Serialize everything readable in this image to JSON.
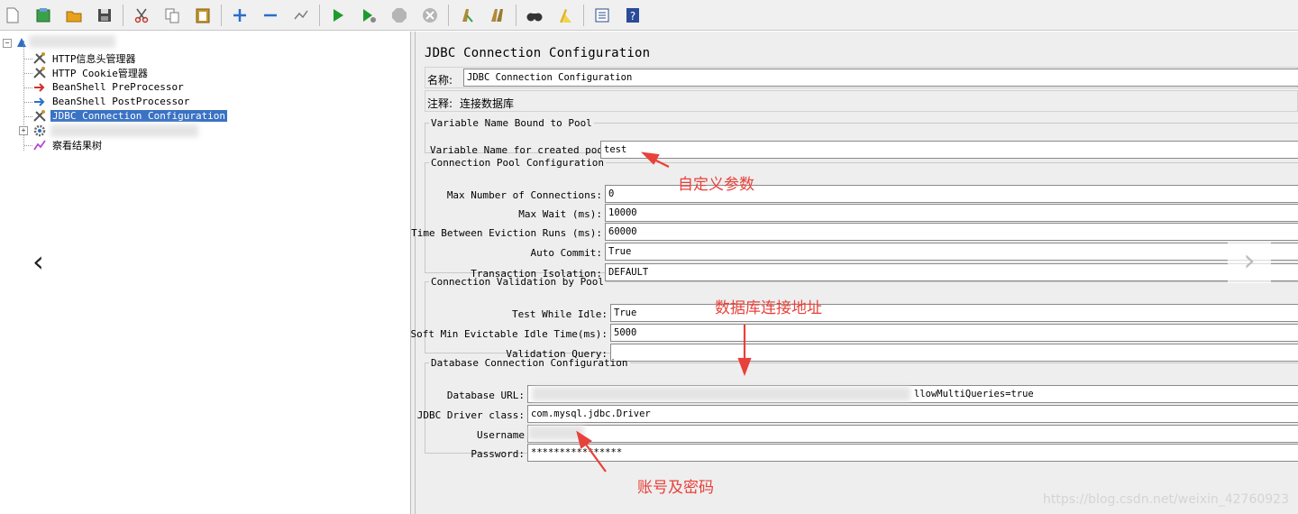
{
  "toolbar": {
    "buttons": [
      {
        "icon": "new-icon",
        "color": "#ffffff"
      },
      {
        "icon": "templates-icon",
        "color": "#3aa04a"
      },
      {
        "icon": "open-icon",
        "color": "#e6a21c"
      },
      {
        "icon": "save-icon",
        "color": "#4a4a4a"
      },
      {
        "icon": "cut-icon",
        "color": "#c0392b"
      },
      {
        "icon": "copy-icon",
        "color": "#7a7a7a"
      },
      {
        "icon": "paste-icon",
        "color": "#c6962a"
      },
      {
        "icon": "expand-icon",
        "color": "#2a6ec8"
      },
      {
        "icon": "collapse-icon",
        "color": "#2a6ec8"
      },
      {
        "icon": "toggle-icon",
        "color": "#7a7a7a"
      },
      {
        "icon": "start-icon",
        "color": "#1e9b2e"
      },
      {
        "icon": "start-no-pause-icon",
        "color": "#1e9b2e"
      },
      {
        "icon": "stop-icon",
        "color": "#a8a8a8"
      },
      {
        "icon": "shutdown-icon",
        "color": "#a8a8a8"
      },
      {
        "icon": "clear-icon",
        "color": "#b08a3a"
      },
      {
        "icon": "clear-all-icon",
        "color": "#b08a3a"
      },
      {
        "icon": "search-icon",
        "color": "#333333"
      },
      {
        "icon": "reset-search-icon",
        "color": "#e2b21c"
      },
      {
        "icon": "function-helper-icon",
        "color": "#2a4a8a"
      },
      {
        "icon": "help-icon",
        "color": "#2a4a9a"
      }
    ]
  },
  "tree": {
    "items": [
      {
        "label": "HTTP信息头管理器",
        "icon": "wrench-icon"
      },
      {
        "label": "HTTP Cookie管理器",
        "icon": "wrench-icon"
      },
      {
        "label": "BeanShell PreProcessor",
        "icon": "preprocessor-icon"
      },
      {
        "label": "BeanShell PostProcessor",
        "icon": "postprocessor-icon"
      },
      {
        "label": "JDBC Connection Configuration",
        "icon": "wrench-icon",
        "selected": true
      },
      {
        "label": "",
        "icon": "gear-icon"
      },
      {
        "label": "察看结果树",
        "icon": "listener-icon"
      }
    ]
  },
  "config": {
    "title": "JDBC Connection Configuration",
    "name_label": "名称:",
    "name_value": "JDBC Connection Configuration",
    "comment_label": "注释:",
    "comment_value": "连接数据库",
    "var_group": {
      "legend": "Variable Name Bound to Pool",
      "fields": [
        {
          "label": "Variable Name for created pool:",
          "value": "test"
        }
      ]
    },
    "pool_group": {
      "legend": "Connection Pool Configuration",
      "fields": [
        {
          "label": "Max Number of Connections:",
          "value": "0"
        },
        {
          "label": "Max Wait (ms):",
          "value": "10000"
        },
        {
          "label": "Time Between Eviction Runs (ms):",
          "value": "60000"
        },
        {
          "label": "Auto Commit:",
          "value": "True"
        },
        {
          "label": "Transaction Isolation:",
          "value": "DEFAULT"
        }
      ]
    },
    "validation_group": {
      "legend": "Connection Validation by Pool",
      "fields": [
        {
          "label": "Test While Idle:",
          "value": "True"
        },
        {
          "label": "Soft Min Evictable Idle Time(ms):",
          "value": "5000"
        },
        {
          "label": "Validation Query:",
          "value": ""
        }
      ]
    },
    "db_group": {
      "legend": "Database Connection Configuration",
      "fields": [
        {
          "label": "Database URL:",
          "value": "llowMultiQueries=true"
        },
        {
          "label": "JDBC Driver class:",
          "value": "com.mysql.jdbc.Driver"
        },
        {
          "label": "Username",
          "value": ""
        },
        {
          "label": "Password:",
          "value": "****************"
        }
      ]
    }
  },
  "annotations": {
    "custom_param": "自定义参数",
    "db_url": "数据库连接地址",
    "credentials": "账号及密码",
    "color": "#e8413a"
  },
  "watermark": "https://blog.csdn.net/weixin_42760923"
}
